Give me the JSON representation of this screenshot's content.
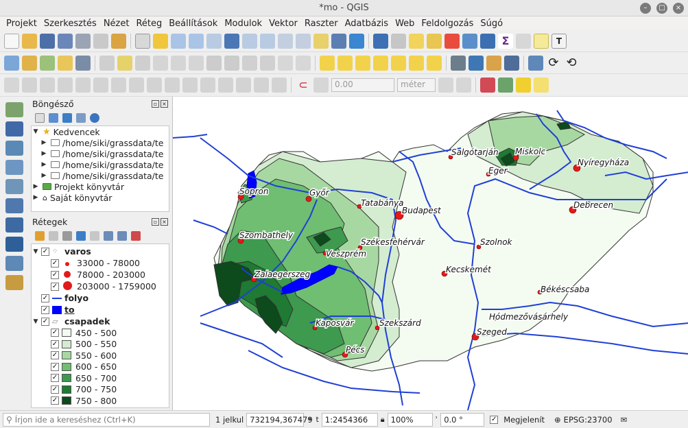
{
  "window": {
    "title": "*mo - QGIS"
  },
  "menu": [
    "Projekt",
    "Szerkesztés",
    "Nézet",
    "Réteg",
    "Beállítások",
    "Modulok",
    "Vektor",
    "Raszter",
    "Adatbázis",
    "Web",
    "Feldolgozás",
    "Súgó"
  ],
  "toolbar": {
    "snap_value": "0.00",
    "snap_unit": "méter"
  },
  "browser": {
    "title": "Böngésző",
    "items": [
      {
        "label": "Kedvencek",
        "icon": "star-icon",
        "level": 0,
        "expanded": true
      },
      {
        "label": "/home/siki/grassdata/te",
        "icon": "folder-icon",
        "level": 1
      },
      {
        "label": "/home/siki/grassdata/te",
        "icon": "folder-icon",
        "level": 1
      },
      {
        "label": "/home/siki/grassdata/te",
        "icon": "folder-icon",
        "level": 1
      },
      {
        "label": "/home/siki/grassdata/te",
        "icon": "folder-icon",
        "level": 1
      },
      {
        "label": "Projekt könyvtár",
        "icon": "project-folder-icon",
        "level": 0
      },
      {
        "label": "Saját könyvtár",
        "icon": "home-icon",
        "level": 0
      }
    ]
  },
  "layers": {
    "title": "Rétegek",
    "varos": {
      "name": "varos",
      "classes": [
        "33000 - 78000",
        "78000 - 203000",
        "203000 - 1759000"
      ]
    },
    "folyo": {
      "name": "folyo",
      "color": "#1f3fd6"
    },
    "to": {
      "name": "to",
      "color": "#0000ff"
    },
    "csapadek": {
      "name": "csapadek",
      "classes": [
        {
          "label": "450 - 500",
          "color": "#f4fbf1"
        },
        {
          "label": "500 - 550",
          "color": "#d4ecd0"
        },
        {
          "label": "550 - 600",
          "color": "#a8d8a2"
        },
        {
          "label": "600 - 650",
          "color": "#6fbe72"
        },
        {
          "label": "650 - 700",
          "color": "#3e9a4e"
        },
        {
          "label": "700 - 750",
          "color": "#1f7a33"
        },
        {
          "label": "750 - 800",
          "color": "#0d4a1c"
        }
      ]
    }
  },
  "map": {
    "cities": [
      "Sopron",
      "Győr",
      "Tatabánya",
      "Budapest",
      "Salgótarján",
      "Miskolc",
      "Eger",
      "Nyíregyháza",
      "Debrecen",
      "Szombathely",
      "Székesfehérvár",
      "Veszprém",
      "Szolnok",
      "Zalaegerszeg",
      "Kecskemét",
      "Békéscsaba",
      "Hódmezővásárhely",
      "Kaposvár",
      "Szekszárd",
      "Szeged",
      "Pécs"
    ]
  },
  "status": {
    "search_placeholder": "Írjon ide a kereséshez (Ctrl+K)",
    "selected": "1 jelkul",
    "coordinate": "732194,367479",
    "scale": "1:2454366",
    "magnifier": "100%",
    "rotation": "0.0 °",
    "render_label": "Megjelenít",
    "crs": "EPSG:23700"
  }
}
